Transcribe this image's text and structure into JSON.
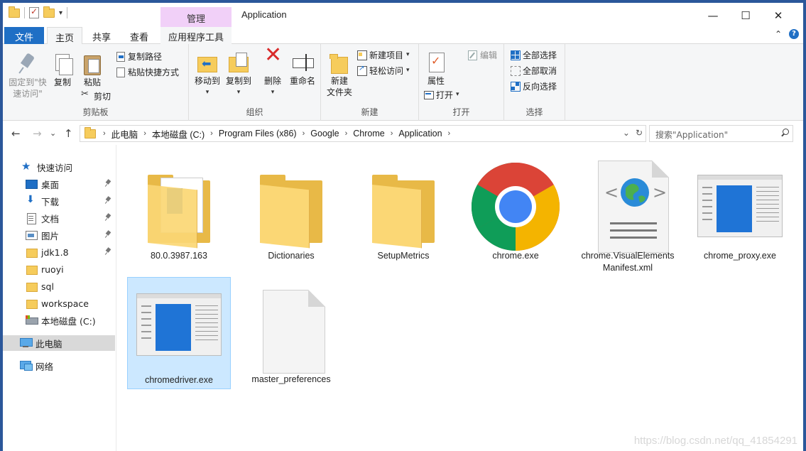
{
  "qat": {
    "dropdown_glyph": "▾"
  },
  "window": {
    "contextual_tab": "管理",
    "title": "Application",
    "minimize_glyph": "—",
    "maximize_glyph": "☐",
    "close_glyph": "✕"
  },
  "tabs": {
    "file": "文件",
    "home": "主页",
    "share": "共享",
    "view": "查看",
    "app_tools": "应用程序工具",
    "collapse_glyph": "⌃",
    "help_glyph": "?"
  },
  "ribbon": {
    "clipboard": {
      "label": "剪贴板",
      "pin_line1": "固定到\"快",
      "pin_line2": "速访问\"",
      "copy": "复制",
      "paste": "粘贴",
      "copy_path": "复制路径",
      "paste_shortcut": "粘贴快捷方式",
      "cut": "剪切"
    },
    "organize": {
      "label": "组织",
      "move_to": "移动到",
      "copy_to": "复制到",
      "delete": "删除",
      "rename": "重命名"
    },
    "new": {
      "label": "新建",
      "new_folder_line1": "新建",
      "new_folder_line2": "文件夹",
      "new_item": "新建项目",
      "easy_access": "轻松访问"
    },
    "open": {
      "label": "打开",
      "properties": "属性",
      "open": "打开",
      "edit": "编辑"
    },
    "select": {
      "label": "选择",
      "select_all": "全部选择",
      "select_none": "全部取消",
      "invert": "反向选择"
    },
    "dropdown_glyph": "▾"
  },
  "nav": {
    "back_glyph": "←",
    "forward_glyph": "→",
    "recent_glyph": "⌄",
    "up_glyph": "↑",
    "breadcrumb": [
      "此电脑",
      "本地磁盘 (C:)",
      "Program Files (x86)",
      "Google",
      "Chrome",
      "Application"
    ],
    "crumb_sep": "›",
    "address_dropdown_glyph": "⌄",
    "refresh_glyph": "↻",
    "search_placeholder": "搜索\"Application\""
  },
  "navpane": {
    "items": [
      {
        "label": "快速访问",
        "icon": "star-icon"
      },
      {
        "label": "桌面",
        "icon": "desktop-icon",
        "pinned": true
      },
      {
        "label": "下载",
        "icon": "download-icon",
        "pinned": true
      },
      {
        "label": "文档",
        "icon": "documents-icon",
        "pinned": true
      },
      {
        "label": "图片",
        "icon": "pictures-icon",
        "pinned": true
      },
      {
        "label": "jdk1.8",
        "icon": "folder-icon",
        "pinned": true
      },
      {
        "label": "ruoyi",
        "icon": "folder-icon"
      },
      {
        "label": "sql",
        "icon": "folder-icon"
      },
      {
        "label": "workspace",
        "icon": "folder-icon"
      },
      {
        "label": "本地磁盘 (C:)",
        "icon": "drive-icon"
      },
      {
        "label": "此电脑",
        "icon": "pc-icon",
        "selected": true
      },
      {
        "label": "网络",
        "icon": "network-icon"
      }
    ]
  },
  "files": [
    {
      "name": "80.0.3987.163",
      "type": "folder-with-doc"
    },
    {
      "name": "Dictionaries",
      "type": "folder"
    },
    {
      "name": "SetupMetrics",
      "type": "folder"
    },
    {
      "name": "chrome.exe",
      "type": "chrome"
    },
    {
      "name_line1": "chrome.VisualElements",
      "name_line2": "Manifest.xml",
      "type": "xml"
    },
    {
      "name": "chrome_proxy.exe",
      "type": "exe"
    },
    {
      "name": "chromedriver.exe",
      "type": "exe",
      "selected": true
    },
    {
      "name": "master_preferences",
      "type": "blank"
    }
  ],
  "watermark": "https://blog.csdn.net/qq_41854291",
  "colors": {
    "accent": "#1f6fc5",
    "frame": "#2b579a",
    "manage_tab": "#f1d0f8",
    "selection": "#cce8ff"
  }
}
